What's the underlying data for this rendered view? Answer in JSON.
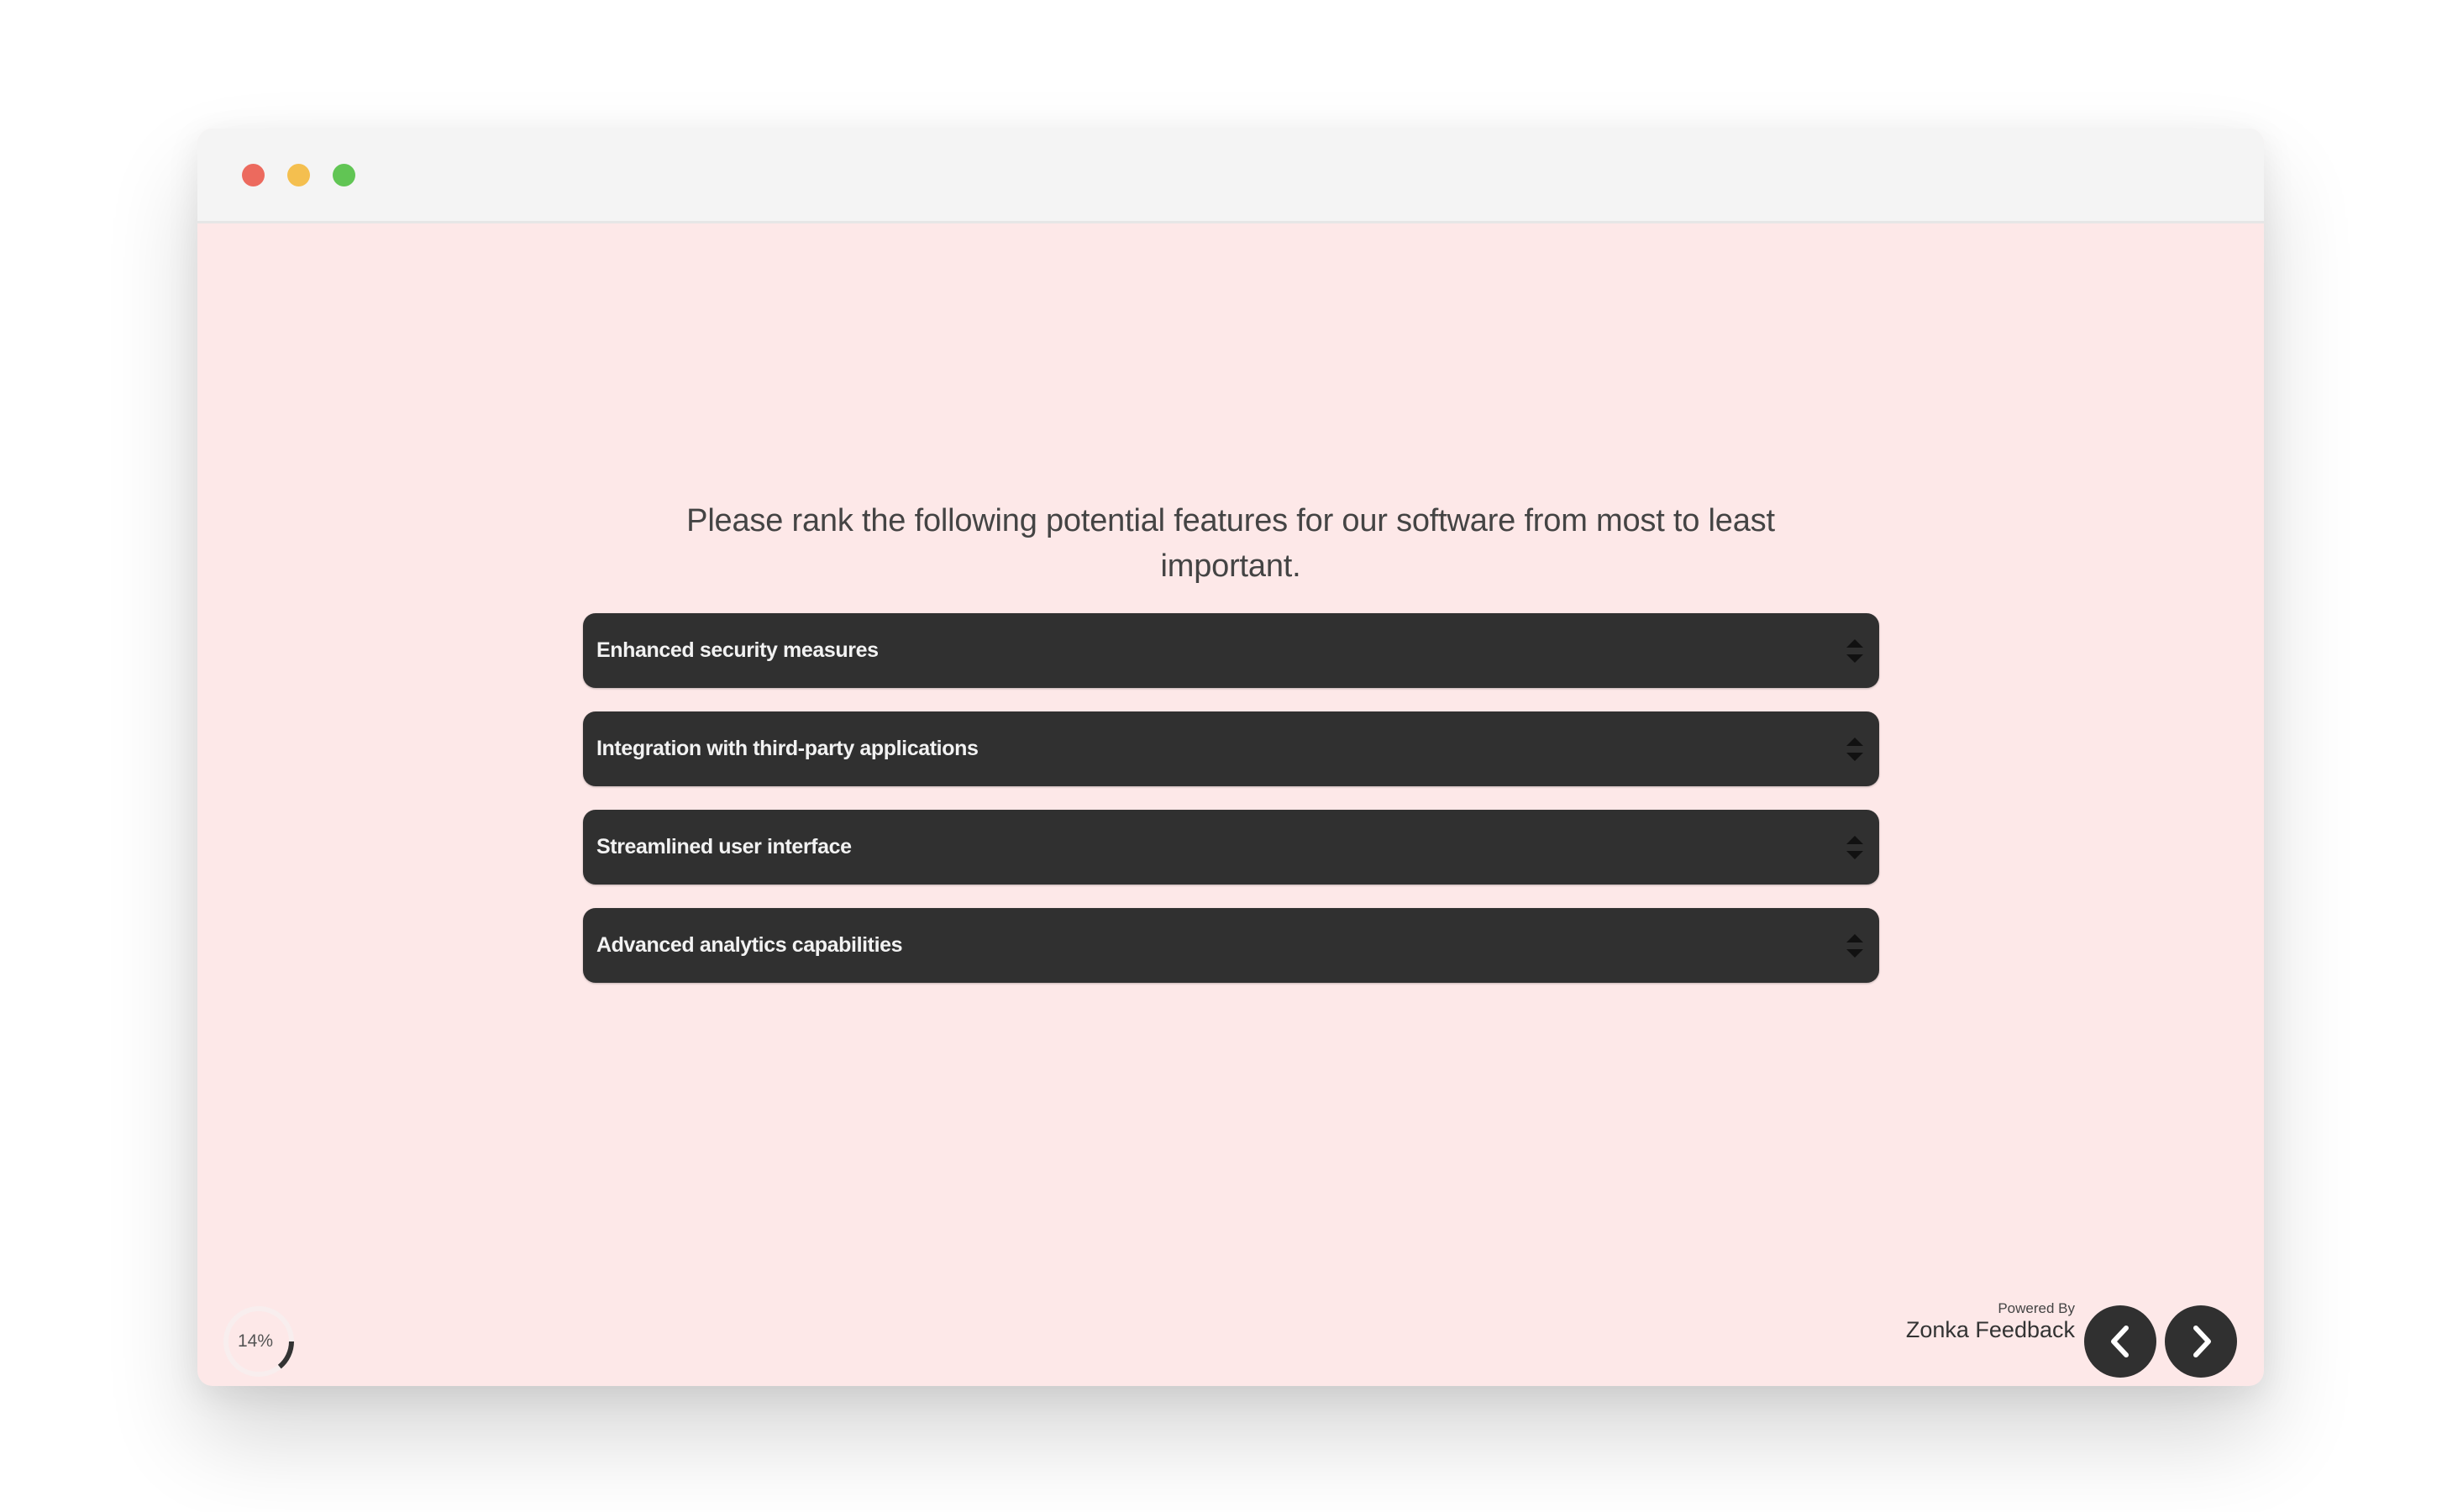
{
  "window": {
    "controls": [
      "close",
      "minimize",
      "maximize"
    ],
    "colors": {
      "close": "#ec6a5e",
      "minimize": "#f4bf4f",
      "maximize": "#61c554"
    }
  },
  "survey": {
    "question_line1": "Please rank the following potential features for our software from most to least",
    "question_line2": "important.",
    "items": [
      {
        "label": "Enhanced security measures",
        "icon": "sort-arrows-icon"
      },
      {
        "label": "Integration with third-party applications",
        "icon": "sort-arrows-icon"
      },
      {
        "label": "Streamlined user interface",
        "icon": "sort-arrows-icon"
      },
      {
        "label": "Advanced analytics capabilities",
        "icon": "sort-arrows-icon"
      }
    ],
    "background_color": "#fde8e8",
    "item_color": "#303030"
  },
  "footer": {
    "progress_percent": 14,
    "progress_label": "14%",
    "powered_by": "Powered By",
    "brand": "Zonka Feedback",
    "prev_icon": "chevron-left-icon",
    "next_icon": "chevron-right-icon"
  }
}
